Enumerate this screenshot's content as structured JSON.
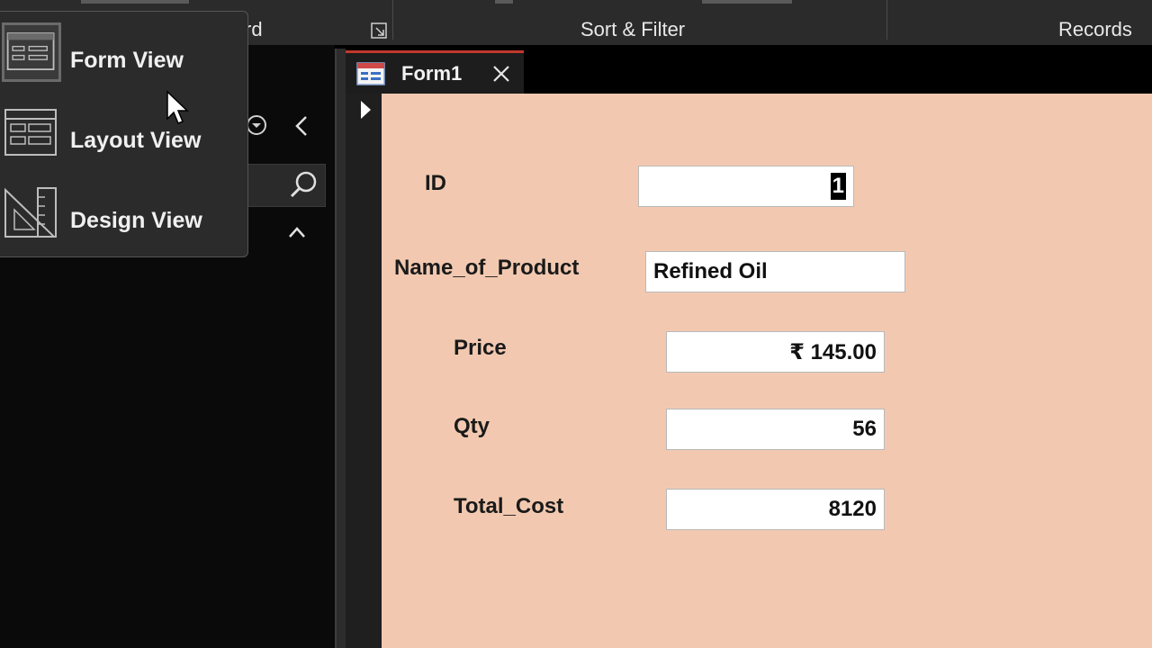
{
  "ribbon": {
    "groups": [
      {
        "label": "rd"
      },
      {
        "label": "Sort & Filter"
      },
      {
        "label": "Records"
      }
    ]
  },
  "view_menu": {
    "items": [
      {
        "label": "Form View",
        "icon": "form-view-icon",
        "active": true
      },
      {
        "label": "Layout View",
        "icon": "layout-view-icon",
        "active": false
      },
      {
        "label": "Design View",
        "icon": "design-view-icon",
        "active": false
      }
    ]
  },
  "document_tab": {
    "label": "Form1",
    "icon": "form-icon"
  },
  "form": {
    "background": "#f2c9b0",
    "fields": [
      {
        "label": "ID",
        "value": "1"
      },
      {
        "label": "Name_of_Product",
        "value": "Refined Oil"
      },
      {
        "label": "Price",
        "value": "₹ 145.00"
      },
      {
        "label": "Qty",
        "value": "56"
      },
      {
        "label": "Total_Cost",
        "value": "8120"
      }
    ]
  },
  "colors": {
    "tab_accent": "#c0392b",
    "ribbon_bg": "#2b2b2b",
    "nav_bg": "#0a0a0a"
  }
}
